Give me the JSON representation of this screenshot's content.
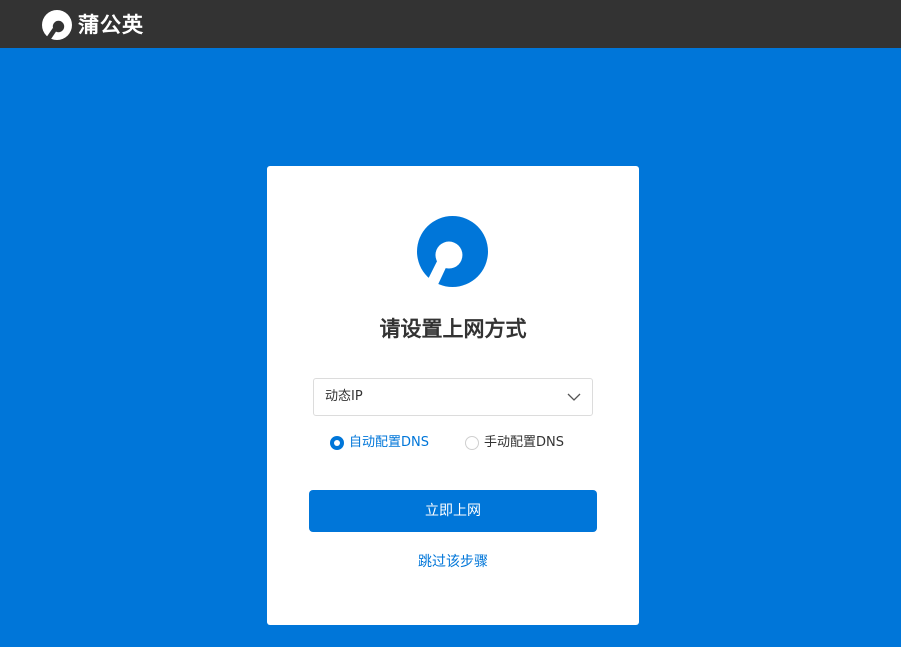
{
  "header": {
    "brand_name": "蒲公英",
    "logo_icon": "pgy-logo-icon"
  },
  "card": {
    "logo_icon": "pgy-logo-icon",
    "title": "请设置上网方式",
    "connection_select": {
      "selected": "动态IP",
      "icon": "chevron-down-icon"
    },
    "dns_options": [
      {
        "label": "自动配置DNS",
        "checked": true
      },
      {
        "label": "手动配置DNS",
        "checked": false
      }
    ],
    "connect_button": "立即上网",
    "skip_link": "跳过该步骤"
  },
  "colors": {
    "accent": "#0076d9",
    "topbar": "#333333",
    "card_bg": "#ffffff",
    "text": "#333333"
  }
}
